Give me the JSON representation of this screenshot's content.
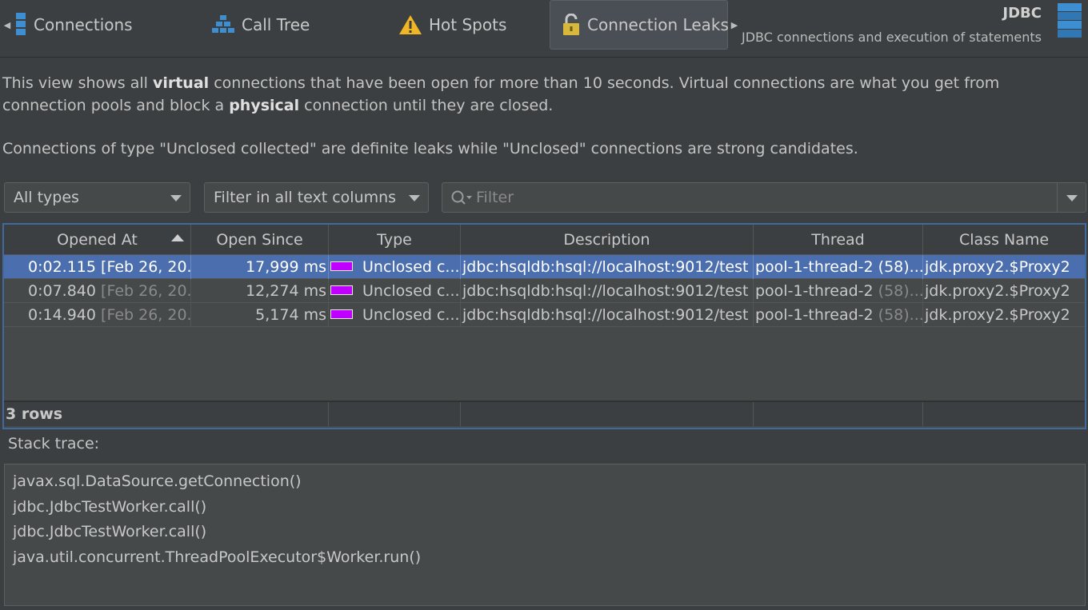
{
  "tabs": [
    {
      "label": "Connections",
      "icon": "database-icon",
      "active": false
    },
    {
      "label": "Call Tree",
      "icon": "call-tree-icon",
      "active": false
    },
    {
      "label": "Hot Spots",
      "icon": "warning-icon",
      "active": false
    },
    {
      "label": "Connection Leaks",
      "icon": "unlocked-lock-icon",
      "active": true
    }
  ],
  "header": {
    "title": "JDBC",
    "subtitle": "JDBC connections and execution of statements"
  },
  "description": {
    "p1_a": "This view shows all ",
    "p1_b1": "virtual",
    "p1_c": " connections that have been open for more than 10 seconds. Virtual connections are what you get from connection pools and block a ",
    "p1_b2": "physical",
    "p1_d": " connection until they are closed.",
    "p2": "Connections of type \"Unclosed collected\" are definite leaks while \"Unclosed\" connections are strong candidates."
  },
  "filters": {
    "type_value": "All types",
    "column_value": "Filter in all text columns",
    "filter_placeholder": "Filter"
  },
  "table": {
    "columns": [
      "Opened At",
      "Open Since",
      "Type",
      "Description",
      "Thread",
      "Class Name"
    ],
    "rows": [
      {
        "opened": "0:02.115",
        "opened_date": "[Feb 26, 20...",
        "since": "17,999 ms",
        "type": "Unclosed c...",
        "description": "jdbc:hsqldb:hsql://localhost:9012/test",
        "thread": "pool-1-thread-2",
        "thread_id": "(58)...",
        "class": "jdk.proxy2.$Proxy2",
        "selected": true
      },
      {
        "opened": "0:07.840",
        "opened_date": "[Feb 26, 20...",
        "since": "12,274 ms",
        "type": "Unclosed c...",
        "description": "jdbc:hsqldb:hsql://localhost:9012/test",
        "thread": "pool-1-thread-2",
        "thread_id": "(58)...",
        "class": "jdk.proxy2.$Proxy2",
        "selected": false
      },
      {
        "opened": "0:14.940",
        "opened_date": "[Feb 26, 20...",
        "since": "5,174 ms",
        "type": "Unclosed c...",
        "description": "jdbc:hsqldb:hsql://localhost:9012/test",
        "thread": "pool-1-thread-2",
        "thread_id": "(58)...",
        "class": "jdk.proxy2.$Proxy2",
        "selected": false
      }
    ],
    "footer": "3 rows"
  },
  "stack": {
    "label": "Stack trace:",
    "lines": [
      "javax.sql.DataSource.getConnection()",
      "jdbc.JdbcTestWorker.call()",
      "jdbc.JdbcTestWorker.call()",
      "java.util.concurrent.ThreadPoolExecutor$Worker.run()"
    ]
  },
  "colors": {
    "selection": "#4b6eaf",
    "type_swatch": "#c000ff",
    "focus_border": "#3f6a9b"
  }
}
